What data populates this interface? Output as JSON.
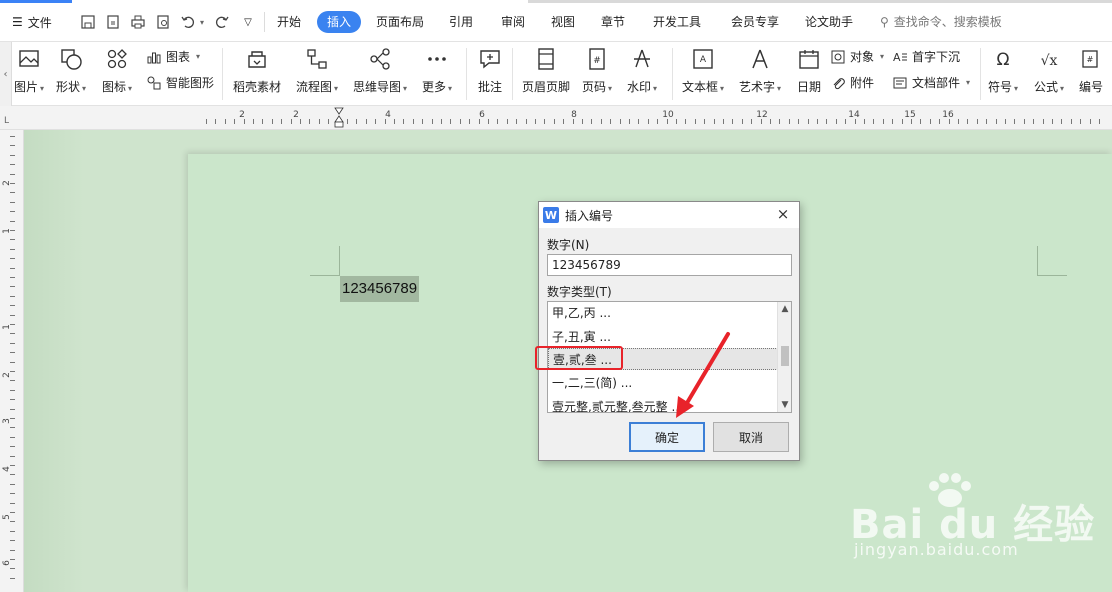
{
  "menubar": {
    "file_label": "文件",
    "tabs": [
      "开始",
      "插入",
      "页面布局",
      "引用",
      "审阅",
      "视图",
      "章节",
      "开发工具",
      "会员专享",
      "论文助手"
    ],
    "active_tab": "插入",
    "search_placeholder": "查找命令、搜索模板"
  },
  "ribbon": {
    "picture": "图片",
    "shape": "形状",
    "icon": "图标",
    "chart": "图表",
    "smart_graphic": "智能图形",
    "material": "稻壳素材",
    "flowchart": "流程图",
    "mindmap": "思维导图",
    "more": "更多",
    "comment": "批注",
    "header_footer": "页眉页脚",
    "page_number": "页码",
    "watermark": "水印",
    "textbox": "文本框",
    "wordart": "艺术字",
    "date": "日期",
    "object": "对象",
    "dropcap": "首字下沉",
    "attachment": "附件",
    "doc_parts": "文档部件",
    "symbol": "符号",
    "formula": "公式",
    "numbering": "编号"
  },
  "ruler": {
    "corner": "L",
    "numbers": [
      "2",
      "2",
      "4",
      "6",
      "8",
      "10",
      "12",
      "14",
      "15",
      "16"
    ],
    "vertical_numbers": [
      "2",
      "1",
      "1",
      "2",
      "3",
      "4",
      "5",
      "6"
    ]
  },
  "document": {
    "selected_text": "123456789"
  },
  "dialog": {
    "title": "插入编号",
    "close": "×",
    "number_label": "数字(N)",
    "number_value": "123456789",
    "type_label": "数字类型(T)",
    "type_options": [
      "甲,乙,丙 ...",
      "子,丑,寅 ...",
      "壹,贰,叁 ...",
      "一,二,三(简) ...",
      "壹元整,贰元整,叁元整 ..."
    ],
    "selected_option": "壹,贰,叁 ...",
    "ok_label": "确定",
    "cancel_label": "取消"
  },
  "watermark": {
    "main": "Bai du 经验",
    "sub": "jingyan.baidu.com"
  },
  "colors": {
    "accent": "#3a83f0",
    "canvas": "#cfe4cd",
    "page": "#cbe6cb",
    "highlight": "#e8232a"
  }
}
